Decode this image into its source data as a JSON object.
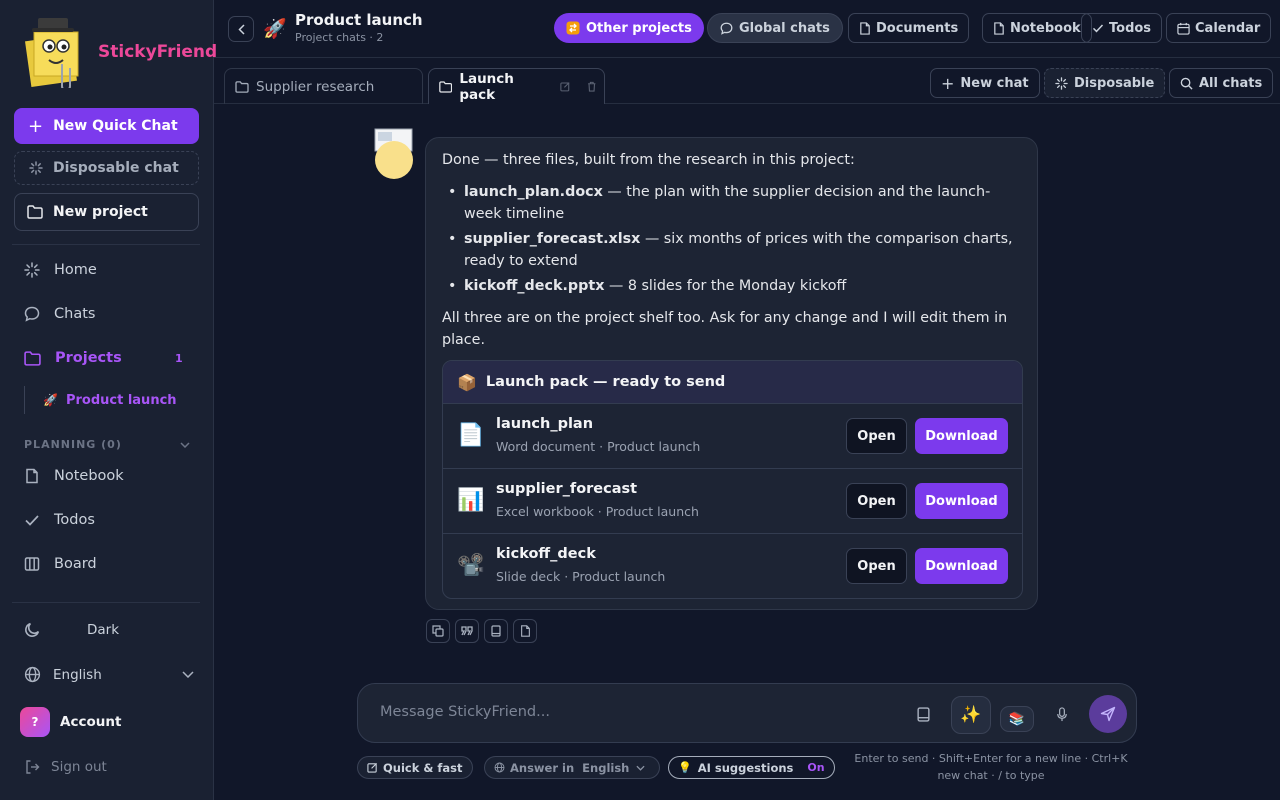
{
  "app": {
    "name": "StickyFriend",
    "accent": "#7c3aed",
    "brand_color": "#ec4899"
  },
  "sidebar": {
    "new_quick_chat": "New Quick Chat",
    "disposable_chat": "Disposable chat",
    "new_project": "New project",
    "nav": [
      {
        "label": "Home",
        "icon": "sparkle-icon"
      },
      {
        "label": "Chats",
        "icon": "chat-bubble-icon"
      },
      {
        "label": "Projects",
        "icon": "folder-icon",
        "badge": "1",
        "active": true
      }
    ],
    "subproject": {
      "emoji": "🚀",
      "label": "Product launch"
    },
    "planning_header": "PLANNING (0)",
    "planning": [
      {
        "label": "Notebook",
        "icon": "notebook-icon"
      },
      {
        "label": "Todos",
        "icon": "check-icon"
      },
      {
        "label": "Board",
        "icon": "board-icon"
      }
    ],
    "theme": "Dark",
    "language": "English",
    "account": {
      "initial": "?",
      "label": "Account"
    },
    "sign_out": "Sign out"
  },
  "header": {
    "emoji": "🚀",
    "title": "Product launch",
    "subtitle": "Project chats · 2",
    "other_projects": "Other projects",
    "global_chats": "Global chats",
    "documents": "Documents",
    "notebook": "Notebook",
    "todos": "Todos",
    "calendar": "Calendar"
  },
  "tabs": [
    {
      "label": "Supplier research",
      "active": false
    },
    {
      "label": "Launch pack",
      "active": true
    }
  ],
  "tab_actions": {
    "new_chat": "New chat",
    "disposable": "Disposable",
    "all_chats": "All chats"
  },
  "message": {
    "intro": "Done — three files, built from the research in this project:",
    "items": [
      {
        "name": "launch_plan.docx",
        "desc": " — the plan with the supplier decision and the launch-week timeline"
      },
      {
        "name": "supplier_forecast.xlsx",
        "desc": " — six months of prices with the comparison charts, ready to extend"
      },
      {
        "name": "kickoff_deck.pptx",
        "desc": " — 8 slides for the Monday kickoff"
      }
    ],
    "outro": "All three are on the project shelf too. Ask for any change and I will edit them in place.",
    "pack": {
      "emoji": "📦",
      "title": "Launch pack — ready to send",
      "open_label": "Open",
      "download_label": "Download",
      "files": [
        {
          "icon": "📄",
          "name": "launch_plan",
          "meta": "Word document · Product launch"
        },
        {
          "icon": "📊",
          "name": "supplier_forecast",
          "meta": "Excel workbook · Product launch"
        },
        {
          "icon": "📽️",
          "name": "kickoff_deck",
          "meta": "Slide deck · Product launch"
        }
      ]
    }
  },
  "composer": {
    "placeholder": "Message StickyFriend...",
    "spark_emoji": "✨",
    "books_emoji": "📚",
    "mode": "Quick & fast",
    "answer_in_label": "Answer in",
    "answer_in_value": "English",
    "ai_suggestions": "AI suggestions",
    "ai_suggestions_state": "On",
    "bulb_emoji": "💡",
    "hint_line1": "Enter to send · Shift+Enter for a new line · Ctrl+K",
    "hint_line2": "new chat · / to type"
  }
}
